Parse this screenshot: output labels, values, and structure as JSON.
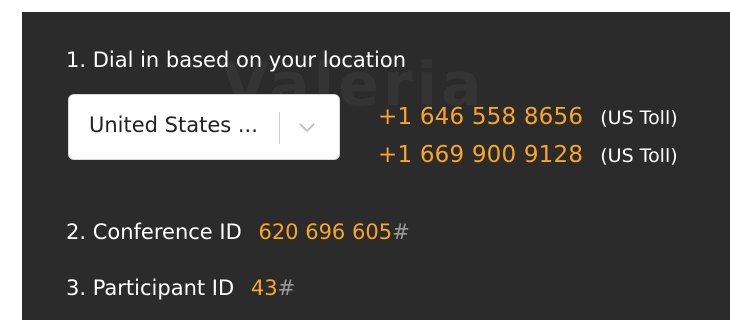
{
  "watermark": "Valeria",
  "step1": {
    "title": "1. Dial in based on your location",
    "country_select": {
      "selected": "United States ..."
    },
    "numbers": [
      {
        "number": "+1 646 558 8656",
        "type": "(US Toll)"
      },
      {
        "number": "+1 669 900 9128",
        "type": "(US Toll)"
      }
    ]
  },
  "step2": {
    "label": "2. Conference ID",
    "value": "620 696 605",
    "suffix": "#"
  },
  "step3": {
    "label": "3. Participant ID",
    "value": "43",
    "suffix": "#"
  },
  "colors": {
    "panel_bg": "#2b2b2b",
    "accent": "#f7a52a",
    "text": "#ffffff"
  }
}
